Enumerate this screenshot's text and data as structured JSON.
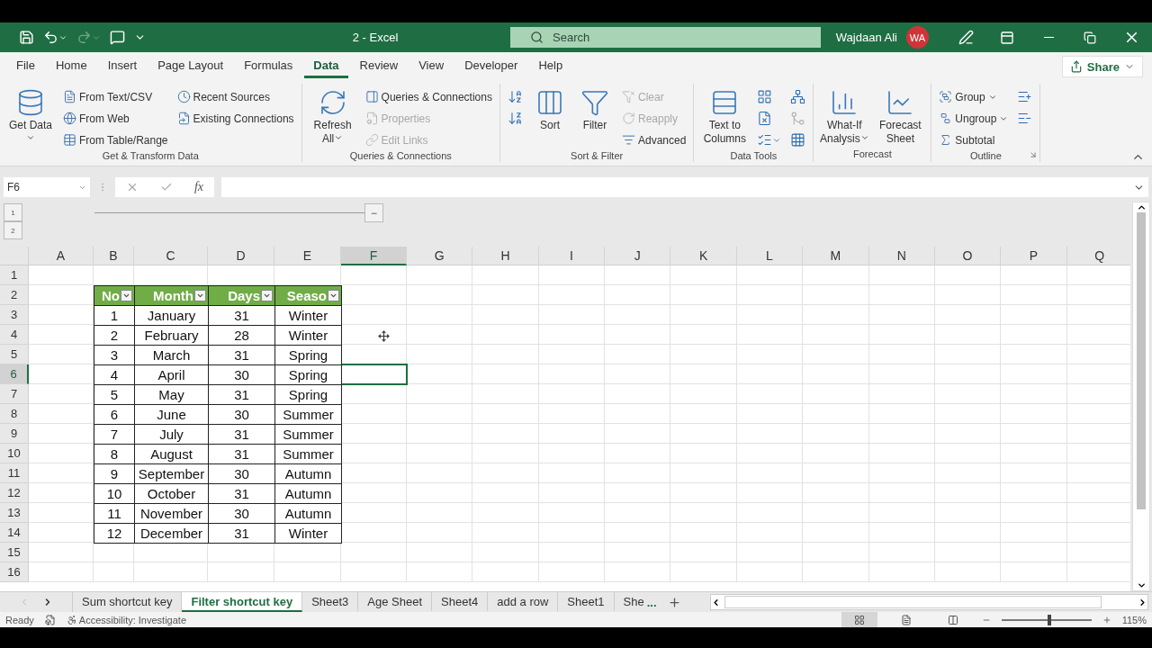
{
  "title_bar": {
    "title": "2  -  Excel",
    "search_placeholder": "Search",
    "user_name": "Wajdaan Ali",
    "avatar_initials": "WA"
  },
  "menu_tabs": [
    {
      "label": "File",
      "selected": false
    },
    {
      "label": "Home",
      "selected": false
    },
    {
      "label": "Insert",
      "selected": false
    },
    {
      "label": "Page Layout",
      "selected": false
    },
    {
      "label": "Formulas",
      "selected": false
    },
    {
      "label": "Data",
      "selected": true
    },
    {
      "label": "Review",
      "selected": false
    },
    {
      "label": "View",
      "selected": false
    },
    {
      "label": "Developer",
      "selected": false
    },
    {
      "label": "Help",
      "selected": false
    }
  ],
  "share_button": "Share",
  "ribbon_groups": [
    {
      "name": "Get & Transform Data",
      "columns": [
        [
          {
            "kind": "large",
            "label": "Get Data",
            "dropdown": true,
            "disabled": false
          }
        ],
        [
          {
            "kind": "small",
            "label": "From Text/CSV",
            "dropdown": false,
            "disabled": false
          },
          {
            "kind": "small",
            "label": "From Web",
            "dropdown": false,
            "disabled": false
          },
          {
            "kind": "small",
            "label": "From Table/Range",
            "dropdown": false,
            "disabled": false
          }
        ],
        [
          {
            "kind": "small",
            "label": "Recent Sources",
            "dropdown": false,
            "disabled": false
          },
          {
            "kind": "small",
            "label": "Existing Connections",
            "dropdown": false,
            "disabled": false
          }
        ]
      ]
    },
    {
      "name": "Queries & Connections",
      "columns": [
        [
          {
            "kind": "large",
            "label": "Refresh All",
            "dropdown": true,
            "disabled": false
          }
        ],
        [
          {
            "kind": "small",
            "label": "Queries & Connections",
            "dropdown": false,
            "disabled": false
          },
          {
            "kind": "small",
            "label": "Properties",
            "dropdown": false,
            "disabled": true
          },
          {
            "kind": "small",
            "label": "Edit Links",
            "dropdown": false,
            "disabled": true
          }
        ]
      ]
    },
    {
      "name": "Sort & Filter",
      "columns": [
        [
          {
            "kind": "icon",
            "dropdown": false,
            "disabled": false
          },
          {
            "kind": "icon",
            "dropdown": false,
            "disabled": false
          }
        ],
        [
          {
            "kind": "large",
            "label": "Sort",
            "dropdown": false,
            "disabled": false
          }
        ],
        [
          {
            "kind": "large",
            "label": "Filter",
            "dropdown": false,
            "disabled": false
          }
        ],
        [
          {
            "kind": "small",
            "label": "Clear",
            "dropdown": false,
            "disabled": true
          },
          {
            "kind": "small",
            "label": "Reapply",
            "dropdown": false,
            "disabled": true
          },
          {
            "kind": "small",
            "label": "Advanced",
            "dropdown": false,
            "disabled": false
          }
        ]
      ]
    },
    {
      "name": "Data Tools",
      "columns": [
        [
          {
            "kind": "large",
            "label": "Text to Columns",
            "dropdown": false,
            "disabled": false
          }
        ],
        [
          {
            "kind": "icon",
            "dropdown": false,
            "disabled": false
          },
          {
            "kind": "icon",
            "dropdown": false,
            "disabled": false
          },
          {
            "kind": "icon",
            "dropdown": true,
            "disabled": false
          }
        ],
        [
          {
            "kind": "icon",
            "dropdown": false,
            "disabled": false
          },
          {
            "kind": "icon",
            "dropdown": false,
            "disabled": true
          },
          {
            "kind": "icon",
            "dropdown": false,
            "disabled": false
          }
        ]
      ]
    },
    {
      "name": "Forecast",
      "columns": [
        [
          {
            "kind": "large",
            "label": "What-If Analysis",
            "dropdown": true,
            "disabled": false
          }
        ],
        [
          {
            "kind": "large",
            "label": "Forecast Sheet",
            "dropdown": false,
            "disabled": false
          }
        ]
      ]
    },
    {
      "name": "Outline",
      "columns": [
        [
          {
            "kind": "small",
            "label": "Group",
            "dropdown": true,
            "disabled": false
          },
          {
            "kind": "small",
            "label": "Ungroup",
            "dropdown": true,
            "disabled": false
          },
          {
            "kind": "small",
            "label": "Subtotal",
            "dropdown": false,
            "disabled": false
          }
        ],
        [
          {
            "kind": "icon",
            "dropdown": false,
            "disabled": false
          },
          {
            "kind": "icon",
            "dropdown": false,
            "disabled": false
          }
        ]
      ]
    }
  ],
  "formula_bar": {
    "name_box": "F6",
    "function_symbol": "fx"
  },
  "outline_levels": [
    "1",
    "2"
  ],
  "collapse_button": "−",
  "columns": [
    {
      "label": "A",
      "selected": false
    },
    {
      "label": "B",
      "selected": false
    },
    {
      "label": "C",
      "selected": false
    },
    {
      "label": "D",
      "selected": false
    },
    {
      "label": "E",
      "selected": false
    },
    {
      "label": "F",
      "selected": true
    },
    {
      "label": "G",
      "selected": false
    },
    {
      "label": "H",
      "selected": false
    },
    {
      "label": "I",
      "selected": false
    },
    {
      "label": "J",
      "selected": false
    },
    {
      "label": "K",
      "selected": false
    },
    {
      "label": "L",
      "selected": false
    },
    {
      "label": "M",
      "selected": false
    },
    {
      "label": "N",
      "selected": false
    },
    {
      "label": "O",
      "selected": false
    },
    {
      "label": "P",
      "selected": false
    },
    {
      "label": "Q",
      "selected": false
    }
  ],
  "rows": [
    {
      "label": "1",
      "selected": false
    },
    {
      "label": "2",
      "selected": false
    },
    {
      "label": "3",
      "selected": false
    },
    {
      "label": "4",
      "selected": false
    },
    {
      "label": "5",
      "selected": false
    },
    {
      "label": "6",
      "selected": true
    },
    {
      "label": "7",
      "selected": false
    },
    {
      "label": "8",
      "selected": false
    },
    {
      "label": "9",
      "selected": false
    },
    {
      "label": "10",
      "selected": false
    },
    {
      "label": "11",
      "selected": false
    },
    {
      "label": "12",
      "selected": false
    },
    {
      "label": "13",
      "selected": false
    },
    {
      "label": "14",
      "selected": false
    },
    {
      "label": "15",
      "selected": false
    },
    {
      "label": "16",
      "selected": false
    }
  ],
  "table": {
    "headers": [
      "No",
      "Month",
      "Days",
      "Seaso"
    ],
    "rows": [
      [
        "1",
        "January",
        "31",
        "Winter"
      ],
      [
        "2",
        "February",
        "28",
        "Winter"
      ],
      [
        "3",
        "March",
        "31",
        "Spring"
      ],
      [
        "4",
        "April",
        "30",
        "Spring"
      ],
      [
        "5",
        "May",
        "31",
        "Spring"
      ],
      [
        "6",
        "June",
        "30",
        "Summer"
      ],
      [
        "7",
        "July",
        "31",
        "Summer"
      ],
      [
        "8",
        "August",
        "31",
        "Summer"
      ],
      [
        "9",
        "September",
        "30",
        "Autumn"
      ],
      [
        "10",
        "October",
        "31",
        "Autumn"
      ],
      [
        "11",
        "November",
        "30",
        "Autumn"
      ],
      [
        "12",
        "December",
        "31",
        "Winter"
      ]
    ]
  },
  "sheet_tabs": [
    {
      "label": "Sum shortcut key",
      "selected": false
    },
    {
      "label": "Filter shortcut key",
      "selected": true
    },
    {
      "label": "Sheet3",
      "selected": false
    },
    {
      "label": "Age Sheet",
      "selected": false
    },
    {
      "label": "Sheet4",
      "selected": false
    },
    {
      "label": "add a row",
      "selected": false
    },
    {
      "label": "Sheet1",
      "selected": false
    },
    {
      "label": "She",
      "selected": false
    }
  ],
  "more_sheets_mark": "...",
  "status_bar": {
    "status": "Ready",
    "accessibility": "Accessibility: Investigate",
    "views": [
      {
        "selected": true
      },
      {
        "selected": false
      },
      {
        "selected": false
      }
    ],
    "zoom": {
      "level": 0.53,
      "reading": "115%"
    }
  }
}
